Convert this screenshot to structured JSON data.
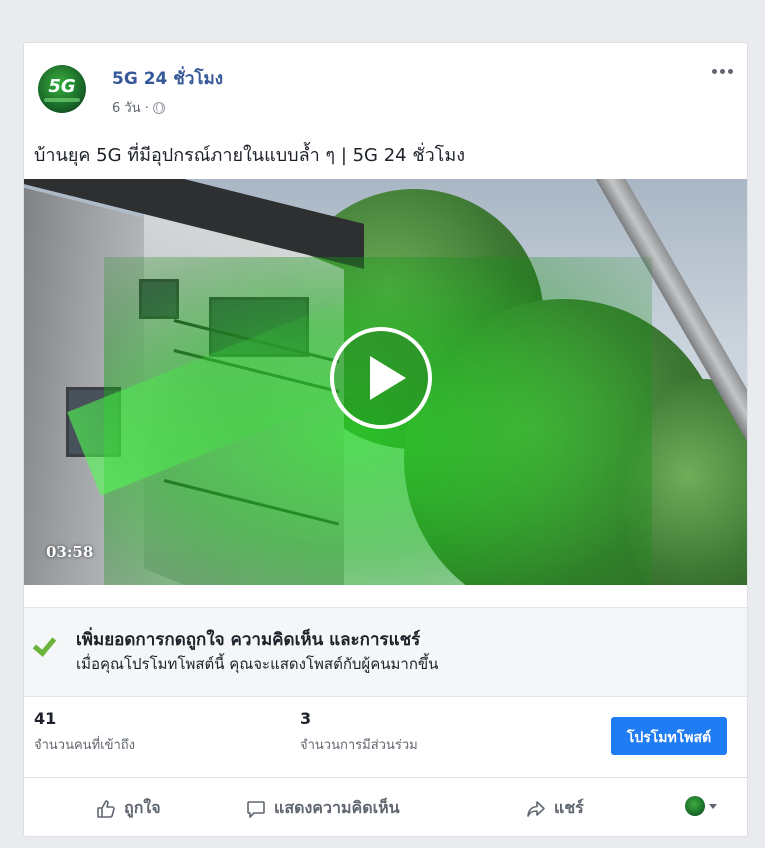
{
  "post": {
    "page_name": "5G 24 ชั่วโมง",
    "avatar_text": "5G",
    "time": "6 วัน ·",
    "privacy_icon": "globe-icon",
    "caption": "บ้านยุค 5G ที่มีอุปกรณ์ภายในแบบล้ำ ๆ | 5G 24 ชั่วโมง"
  },
  "video": {
    "duration": "03:58",
    "play_icon": "play-icon"
  },
  "boost": {
    "title": "เพิ่มยอดการกดถูกใจ ความคิดเห็น และการแชร์",
    "subtitle": "เมื่อคุณโปรโมทโพสต์นี้ คุณจะแสดงโพสต์กับผู้คนมากขึ้น"
  },
  "stats": {
    "reach_value": "41",
    "reach_label": "จำนวนคนที่เข้าถึง",
    "engagement_value": "3",
    "engagement_label": "จำนวนการมีส่วนร่วม",
    "promote_label": "โปรโมทโพสต์"
  },
  "actions": {
    "like": "ถูกใจ",
    "comment": "แสดงความคิดเห็น",
    "share": "แชร์"
  },
  "colors": {
    "link": "#365899",
    "primary_button": "#1f7cf2",
    "check": "#6bb33b",
    "overlay_green": "#28dc28"
  }
}
